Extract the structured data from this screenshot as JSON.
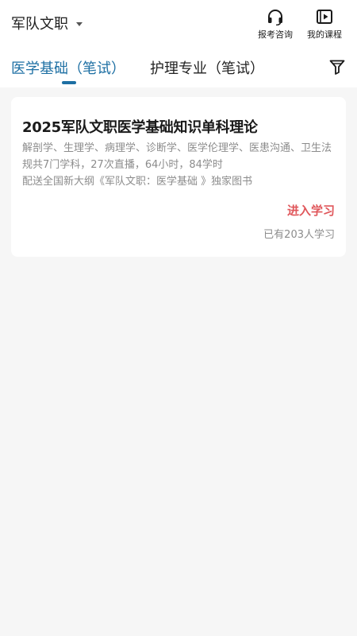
{
  "header": {
    "category": "军队文职",
    "consult_label": "报考咨询",
    "courses_label": "我的课程"
  },
  "tabs": [
    {
      "label": "医学基础（笔试）",
      "active": true
    },
    {
      "label": "护理专业（笔试）",
      "active": false
    }
  ],
  "icons": {
    "category_dropdown": "chevron-down-icon",
    "consult": "headset-icon",
    "courses": "video-play-icon",
    "filter": "filter-icon"
  },
  "colors": {
    "accent": "#1d6fa3",
    "cta": "#e0575b",
    "muted_text": "#8c8c8c",
    "background": "#f6f6f6"
  },
  "course": {
    "title": "2025军队文职医学基础知识单科理论",
    "description": "解剖学、生理学、病理学、诊断学、医学伦理学、医患沟通、卫生法规共7门学科，27次直播，64小时，84学时",
    "book_note": "配送全国新大纲《军队文职：医学基础 》独家图书",
    "enter_label": "进入学习",
    "learners": "已有203人学习"
  }
}
